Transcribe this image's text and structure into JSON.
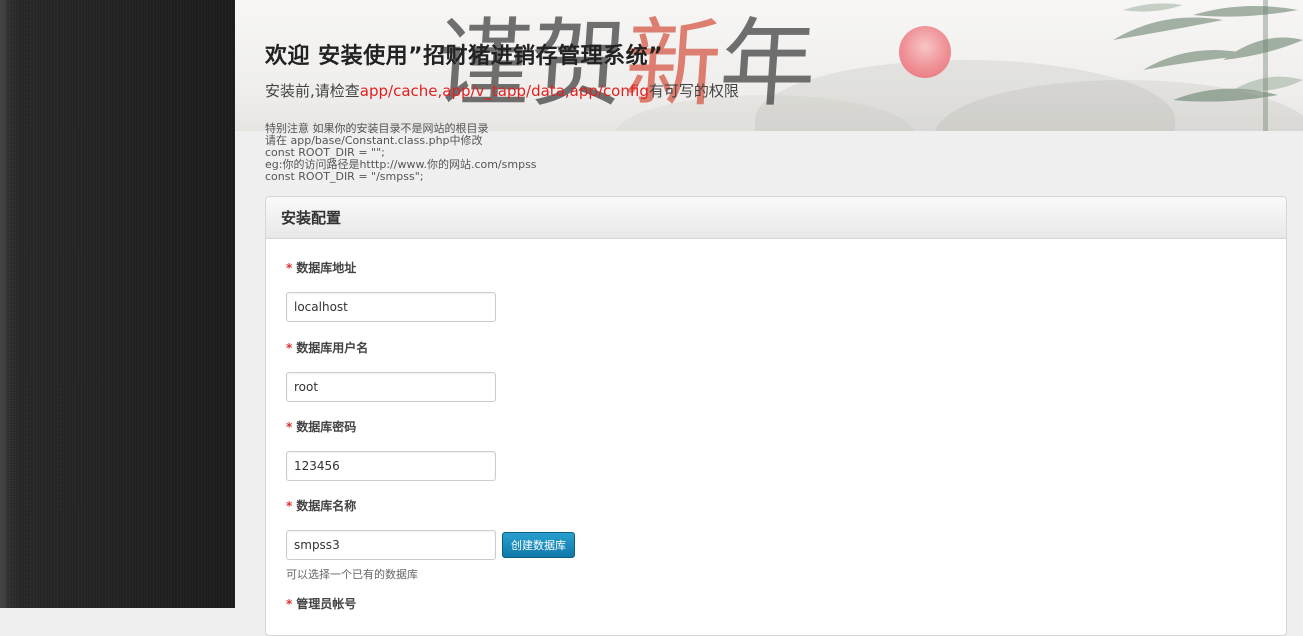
{
  "banner": {
    "calligraphy": [
      "谨",
      "贺",
      "新",
      "年"
    ]
  },
  "header": {
    "title": "欢迎 安装使用”招财猪进销存管理系统”",
    "check_prefix": "安装前,请检查",
    "check_paths": "app/cache,app/v_tapp/data,app/config",
    "check_suffix": "有可写的权限"
  },
  "notes": [
    "特别注意 如果你的安装目录不是网站的根目录",
    "请在 app/base/Constant.class.php中修改",
    "const ROOT_DIR = \"\";",
    "eg:你的访问路径是htttp://www.你的网站.com/smpss",
    "const ROOT_DIR = \"/smpss\";"
  ],
  "panel": {
    "title": "安装配置",
    "required_mark": "*",
    "fields": [
      {
        "label": "数据库地址",
        "value": "localhost"
      },
      {
        "label": "数据库用户名",
        "value": "root"
      },
      {
        "label": "数据库密码",
        "value": "123456"
      },
      {
        "label": "数据库名称",
        "value": "smpss3",
        "button": "创建数据库",
        "hint": "可以选择一个已有的数据库"
      },
      {
        "label": "管理员帐号"
      }
    ]
  },
  "colors": {
    "path_red": "#e02020",
    "button_blue": "#1a88bb",
    "sidebar": "#232323"
  }
}
